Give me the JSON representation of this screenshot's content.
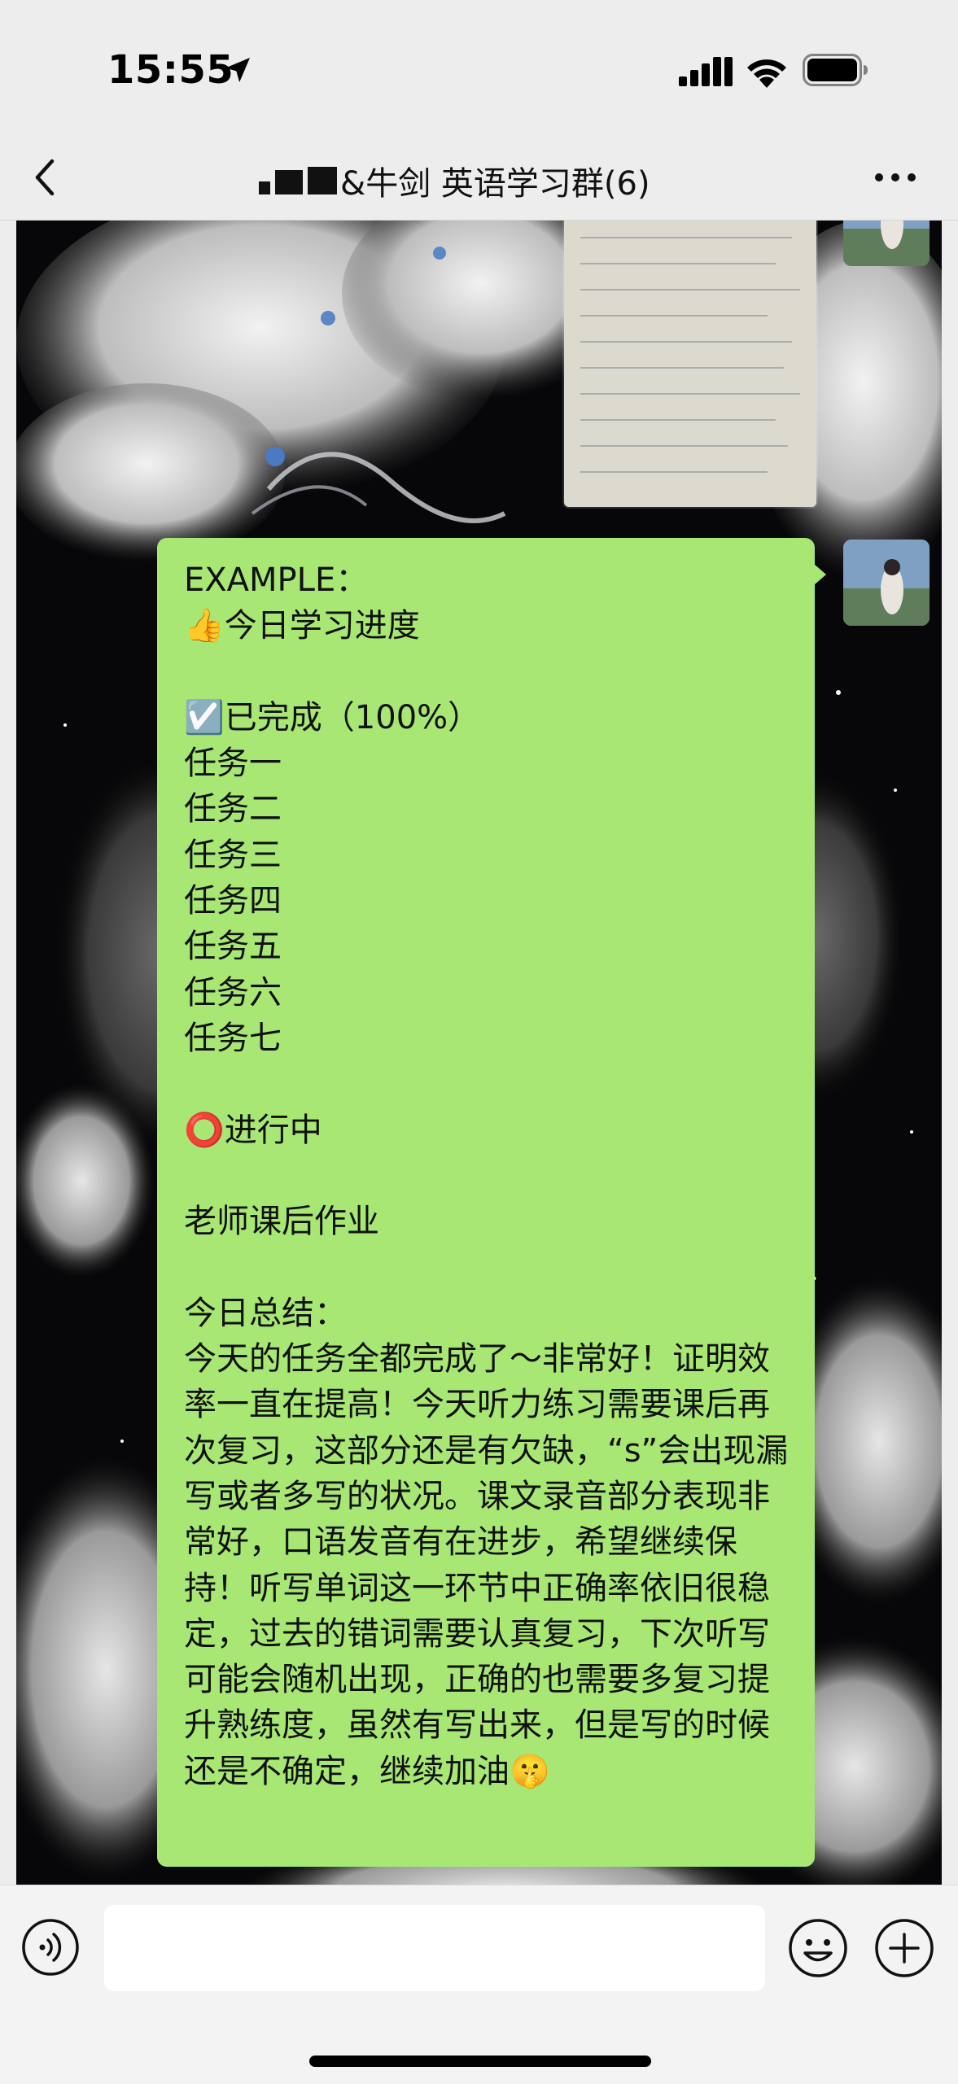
{
  "status_bar": {
    "time": "15:55"
  },
  "nav": {
    "title": "&牛剑 英语学习群(6)"
  },
  "message": {
    "text": "EXAMPLE：\n👍今日学习进度\n\n☑️已完成（100%）\n任务一\n任务二\n任务三\n任务四\n任务五\n任务六\n任务七\n\n⭕️进行中\n\n老师课后作业\n\n今日总结：\n今天的任务全都完成了～非常好！证明效率一直在提高！今天听力练习需要课后再次复习，这部分还是有欠缺，“s”会出现漏写或者多写的状况。课文录音部分表现非常好，口语发音有在进步，希望继续保持！听写单词这一环节中正确率依旧很稳定，过去的错词需要认真复习，下次听写可能会随机出现，正确的也需要多复习提升熟练度，虽然有写出来，但是写的时候还是不确定，继续加油🤫"
  },
  "colors": {
    "bubble": "#a8e774",
    "background": "#ededed",
    "wallpaper": "#070709"
  },
  "icons": {
    "status": [
      "location-arrow-icon",
      "signal-icon",
      "wifi-icon",
      "battery-icon"
    ],
    "nav": [
      "back-icon",
      "more-icon"
    ],
    "input": [
      "voice-icon",
      "emoji-icon",
      "plus-icon"
    ]
  }
}
